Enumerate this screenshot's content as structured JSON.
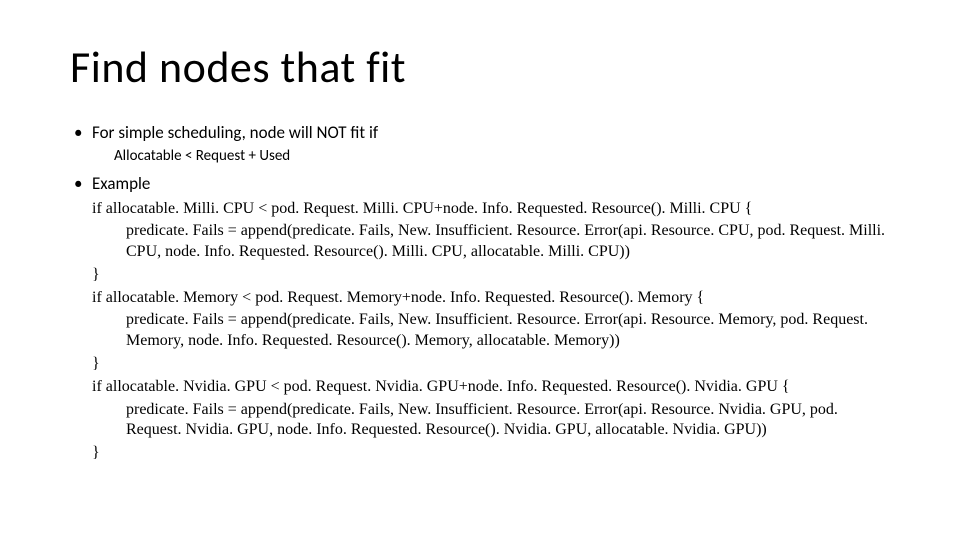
{
  "title": "Find nodes that fit",
  "bullets": {
    "b1": "For simple scheduling, node will NOT fit if",
    "b1_sub": "Allocatable < Request + Used",
    "b2": "Example"
  },
  "code": {
    "l1": "if allocatable. Milli. CPU < pod. Request. Milli. CPU+node. Info. Requested. Resource(). Milli. CPU {",
    "l2": "predicate. Fails = append(predicate. Fails, New. Insufficient. Resource. Error(api. Resource. CPU, pod. Request. Milli. CPU, node. Info. Requested. Resource(). Milli. CPU, allocatable. Milli. CPU))",
    "l3": "}",
    "l4": "if allocatable. Memory < pod. Request. Memory+node. Info. Requested. Resource(). Memory {",
    "l5": "predicate. Fails = append(predicate. Fails, New. Insufficient. Resource. Error(api. Resource. Memory, pod. Request. Memory, node. Info. Requested. Resource(). Memory, allocatable. Memory))",
    "l6": "}",
    "l7": "if allocatable. Nvidia. GPU < pod. Request. Nvidia. GPU+node. Info. Requested. Resource(). Nvidia. GPU {",
    "l8": "predicate. Fails = append(predicate. Fails, New. Insufficient. Resource. Error(api. Resource. Nvidia. GPU, pod. Request. Nvidia. GPU, node. Info. Requested. Resource(). Nvidia. GPU, allocatable. Nvidia. GPU))",
    "l9": "}"
  }
}
